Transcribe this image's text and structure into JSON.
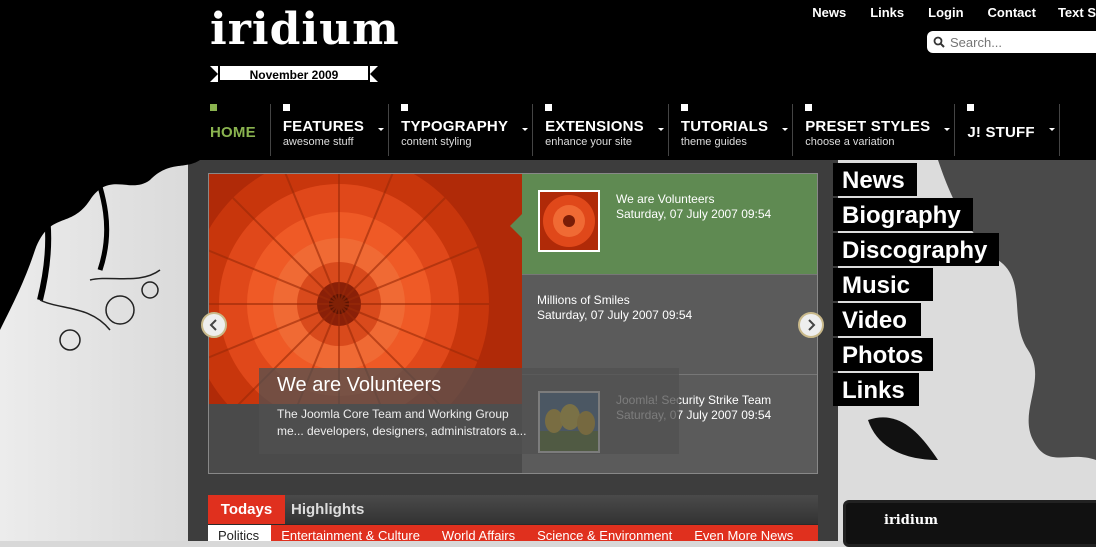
{
  "logo": {
    "word": "iridium",
    "date": "November 2009"
  },
  "toplinks": [
    "News",
    "Links",
    "Login",
    "Contact",
    "Text S"
  ],
  "search": {
    "placeholder": "Search..."
  },
  "nav": [
    {
      "label": "HOME",
      "sub": "",
      "active": true
    },
    {
      "label": "FEATURES",
      "sub": "awesome stuff"
    },
    {
      "label": "TYPOGRAPHY",
      "sub": "content styling"
    },
    {
      "label": "EXTENSIONS",
      "sub": "enhance your site"
    },
    {
      "label": "TUTORIALS",
      "sub": "theme guides"
    },
    {
      "label": "PRESET STYLES",
      "sub": "choose a variation"
    },
    {
      "label": "J! STUFF",
      "sub": ""
    }
  ],
  "slideshow": {
    "caption_title": "We are Volunteers",
    "caption_text": "The Joomla Core Team and Working Group me... developers, designers, administrators a...",
    "items": [
      {
        "title": "We are Volunteers",
        "date": "Saturday, 07 July 2007 09:54"
      },
      {
        "title": "Millions of Smiles",
        "date": "Saturday, 07 July 2007 09:54"
      },
      {
        "title": "Joomla! Security Strike Team",
        "date": "Saturday, 07 July 2007 09:54"
      }
    ]
  },
  "side_menu": [
    "News",
    "Biography",
    "Discography",
    "Music",
    "Video",
    "Photos",
    "Links"
  ],
  "highlights": {
    "todays": "Todays",
    "label": "Highlights",
    "tabs": [
      "Politics",
      "Entertainment & Culture",
      "World Affairs",
      "Science & Environment",
      "Even More News"
    ]
  },
  "promo": {
    "logo": "iridium"
  },
  "colors": {
    "accent_green": "#8ab34f",
    "active_slide": "#5f8a52",
    "highlight_red": "#e0301e"
  }
}
